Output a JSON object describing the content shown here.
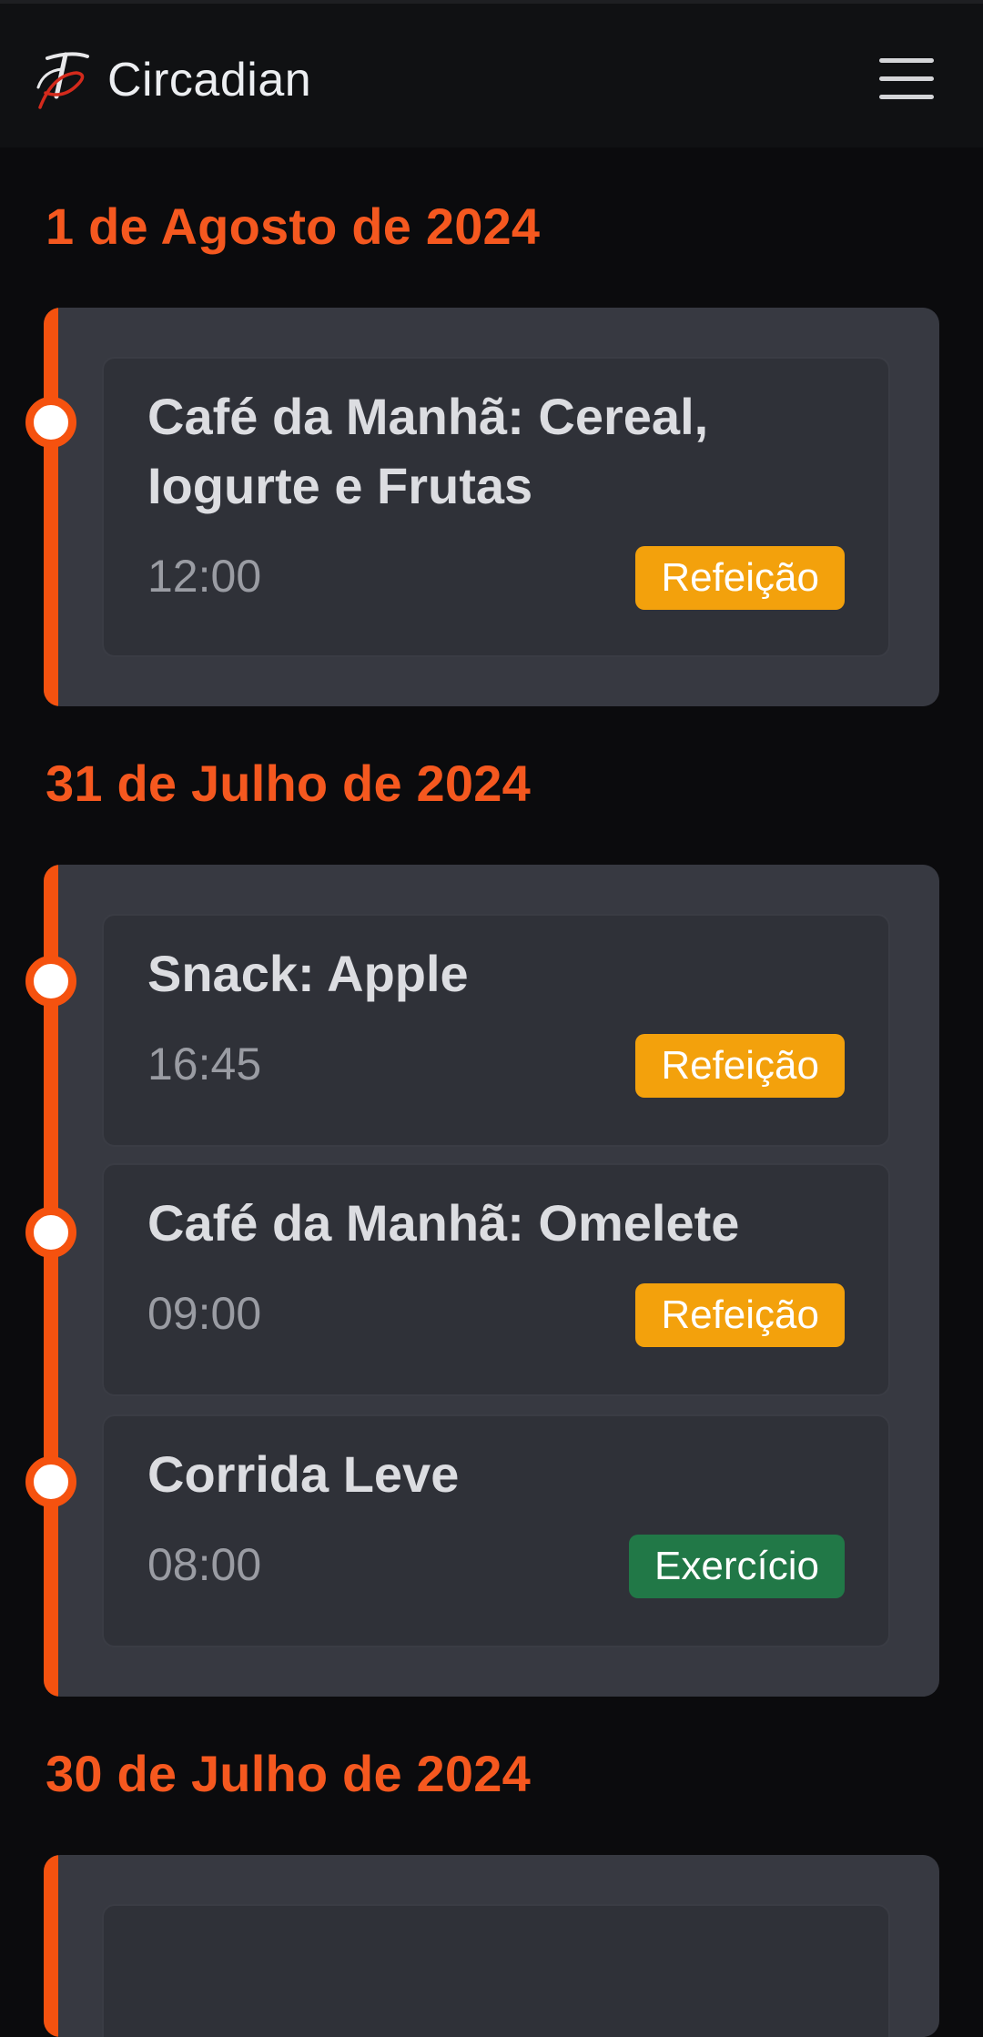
{
  "app": {
    "name": "Circadian",
    "logo_icon": "circadian-logo-icon",
    "menu_icon": "hamburger-menu-icon"
  },
  "colors": {
    "accent": "#f5581f",
    "timeline": "#f5520f",
    "card_bg": "#373941",
    "entry_bg": "#2f3138",
    "meal_badge": "#f3a10c",
    "exercise_badge": "#217847"
  },
  "days": [
    {
      "date": "1 de Agosto de 2024",
      "entries": [
        {
          "title": "Café da Manhã: Cereal, Iogurte e Frutas",
          "time": "12:00",
          "category": "Refeição"
        }
      ]
    },
    {
      "date": "31 de Julho de 2024",
      "entries": [
        {
          "title": "Snack: Apple",
          "time": "16:45",
          "category": "Refeição"
        },
        {
          "title": "Café da Manhã: Omelete",
          "time": "09:00",
          "category": "Refeição"
        },
        {
          "title": "Corrida Leve",
          "time": "08:00",
          "category": "Exercício"
        }
      ]
    },
    {
      "date": "30 de Julho de 2024",
      "entries": []
    }
  ]
}
